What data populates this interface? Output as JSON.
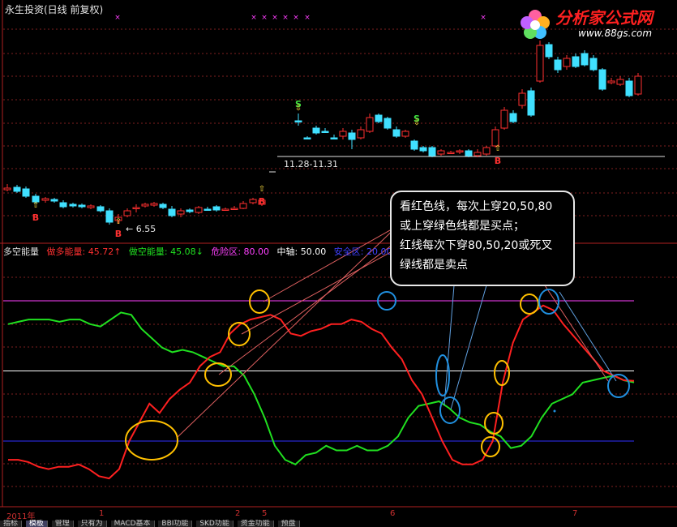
{
  "window": {
    "title": "永生投资(日线 前复权)"
  },
  "logo": {
    "text": "分析家公式网",
    "url": "www.88gs.com"
  },
  "price_chart": {
    "range_label": "11.28-11.31",
    "low_label": "6.55",
    "signals": {
      "buy": "B",
      "sell": "S"
    }
  },
  "indicator": {
    "name": "多空能量",
    "bull_label": "做多能量: 45.72↑",
    "bear_label": "做空能量: 45.08↓",
    "danger_label": "危险区: 80.00",
    "mid_label": "中轴: 50.00",
    "safe_label": "安全区: 20.00"
  },
  "callout": {
    "line1": "看红色线，每次上穿20,50,80",
    "line2": "或上穿绿色线都是买点；",
    "line3": "红线每次下穿80,50,20或死叉",
    "line4": "绿线都是卖点"
  },
  "time_axis": {
    "year": "2011年",
    "months": [
      "1",
      "2",
      "5",
      "6",
      "7"
    ]
  },
  "tabs": [
    "指标",
    "模板",
    "管理",
    "只有为",
    "MACD基本",
    "BBI功能",
    "SKD功能",
    "资金功能",
    "预盘"
  ],
  "colors": {
    "bull": "#ff2020",
    "bear": "#20e020",
    "danger": "#ff40ff",
    "mid": "#ffffff",
    "safe": "#4040ff",
    "candle_up": "#ff3030",
    "candle_down": "#40e0ff"
  },
  "chart_data": [
    {
      "type": "candlestick",
      "title": "永生投资(日线 前复权)",
      "annotations": [
        "11.28-11.31",
        "6.55",
        "B",
        "S"
      ]
    },
    {
      "type": "line",
      "title": "多空能量",
      "ylim": [
        0,
        100
      ],
      "reference_lines": [
        80,
        50,
        20
      ],
      "series": [
        {
          "name": "做多能量",
          "values": [
            12,
            12,
            11,
            9,
            8,
            9,
            9,
            10,
            8,
            5,
            4,
            8,
            20,
            28,
            36,
            32,
            38,
            42,
            45,
            52,
            56,
            58,
            66,
            70,
            72,
            73,
            74,
            72,
            66,
            65,
            67,
            68,
            70,
            70,
            72,
            71,
            68,
            66,
            60,
            55,
            46,
            40,
            30,
            20,
            12,
            10,
            10,
            12,
            20,
            45,
            62,
            72,
            75,
            78,
            76,
            70,
            65,
            60,
            55,
            50,
            48,
            46,
            45.72
          ]
        },
        {
          "name": "做空能量",
          "values": [
            70,
            71,
            72,
            72,
            72,
            71,
            72,
            72,
            70,
            69,
            72,
            75,
            74,
            68,
            64,
            60,
            58,
            59,
            58,
            56,
            54,
            52,
            52,
            48,
            40,
            30,
            18,
            12,
            10,
            14,
            15,
            18,
            16,
            16,
            18,
            16,
            16,
            18,
            22,
            30,
            35,
            36,
            37,
            34,
            30,
            28,
            27,
            24,
            22,
            17,
            18,
            22,
            30,
            36,
            38,
            40,
            45,
            46,
            47,
            48,
            46,
            45.08
          ]
        }
      ]
    }
  ]
}
